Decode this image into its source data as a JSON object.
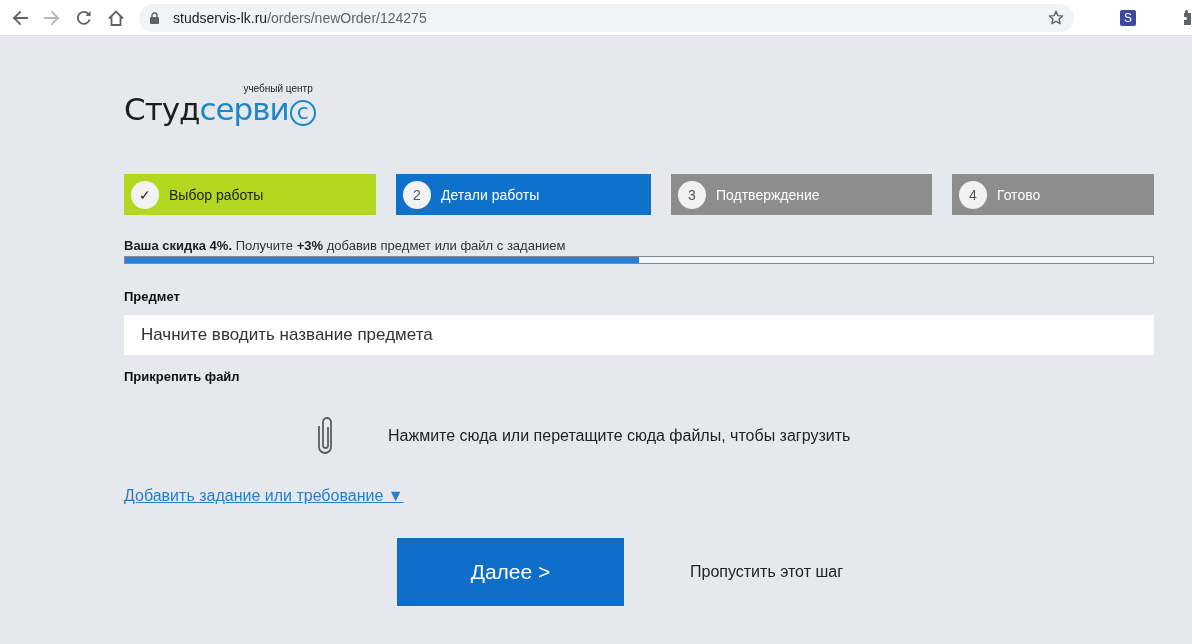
{
  "browser": {
    "nav_buttons": [
      {
        "kind": "back",
        "disabled": false
      },
      {
        "kind": "forward",
        "disabled": true
      },
      {
        "kind": "reload",
        "disabled": false
      },
      {
        "kind": "home",
        "disabled": false
      }
    ],
    "url_host": "studservis-lk.ru",
    "url_path": "/orders/newOrder/124275",
    "extension_label": "S"
  },
  "logo": {
    "tagline": "учебный центр",
    "name_dark": "Студ",
    "name_accent": "серви",
    "name_circled": "с"
  },
  "steps": [
    {
      "kind": "done",
      "marker": "✓",
      "label": "Выбор работы"
    },
    {
      "kind": "current",
      "marker": "2",
      "label": "Детали работы"
    },
    {
      "kind": "pending",
      "marker": "3",
      "label": "Подтверждение"
    },
    {
      "kind": "pending",
      "marker": "4",
      "label": "Готово"
    }
  ],
  "discount": {
    "text": "**Ваша скидка 4%.** Получите **+3%** добавив предмет или файл с заданием",
    "level": 0.5
  },
  "subject": {
    "label": "Предмет",
    "placeholder": "Начните вводить название предмета"
  },
  "attach": {
    "label": "Прикрепить файл",
    "hint": "Нажмите сюда или перетащите сюда файлы, чтобы загрузить"
  },
  "add_task_link": "Добавить задание или требование ▼",
  "next_button": "Далее >",
  "skip_link": "Пропустить этот шаг"
}
